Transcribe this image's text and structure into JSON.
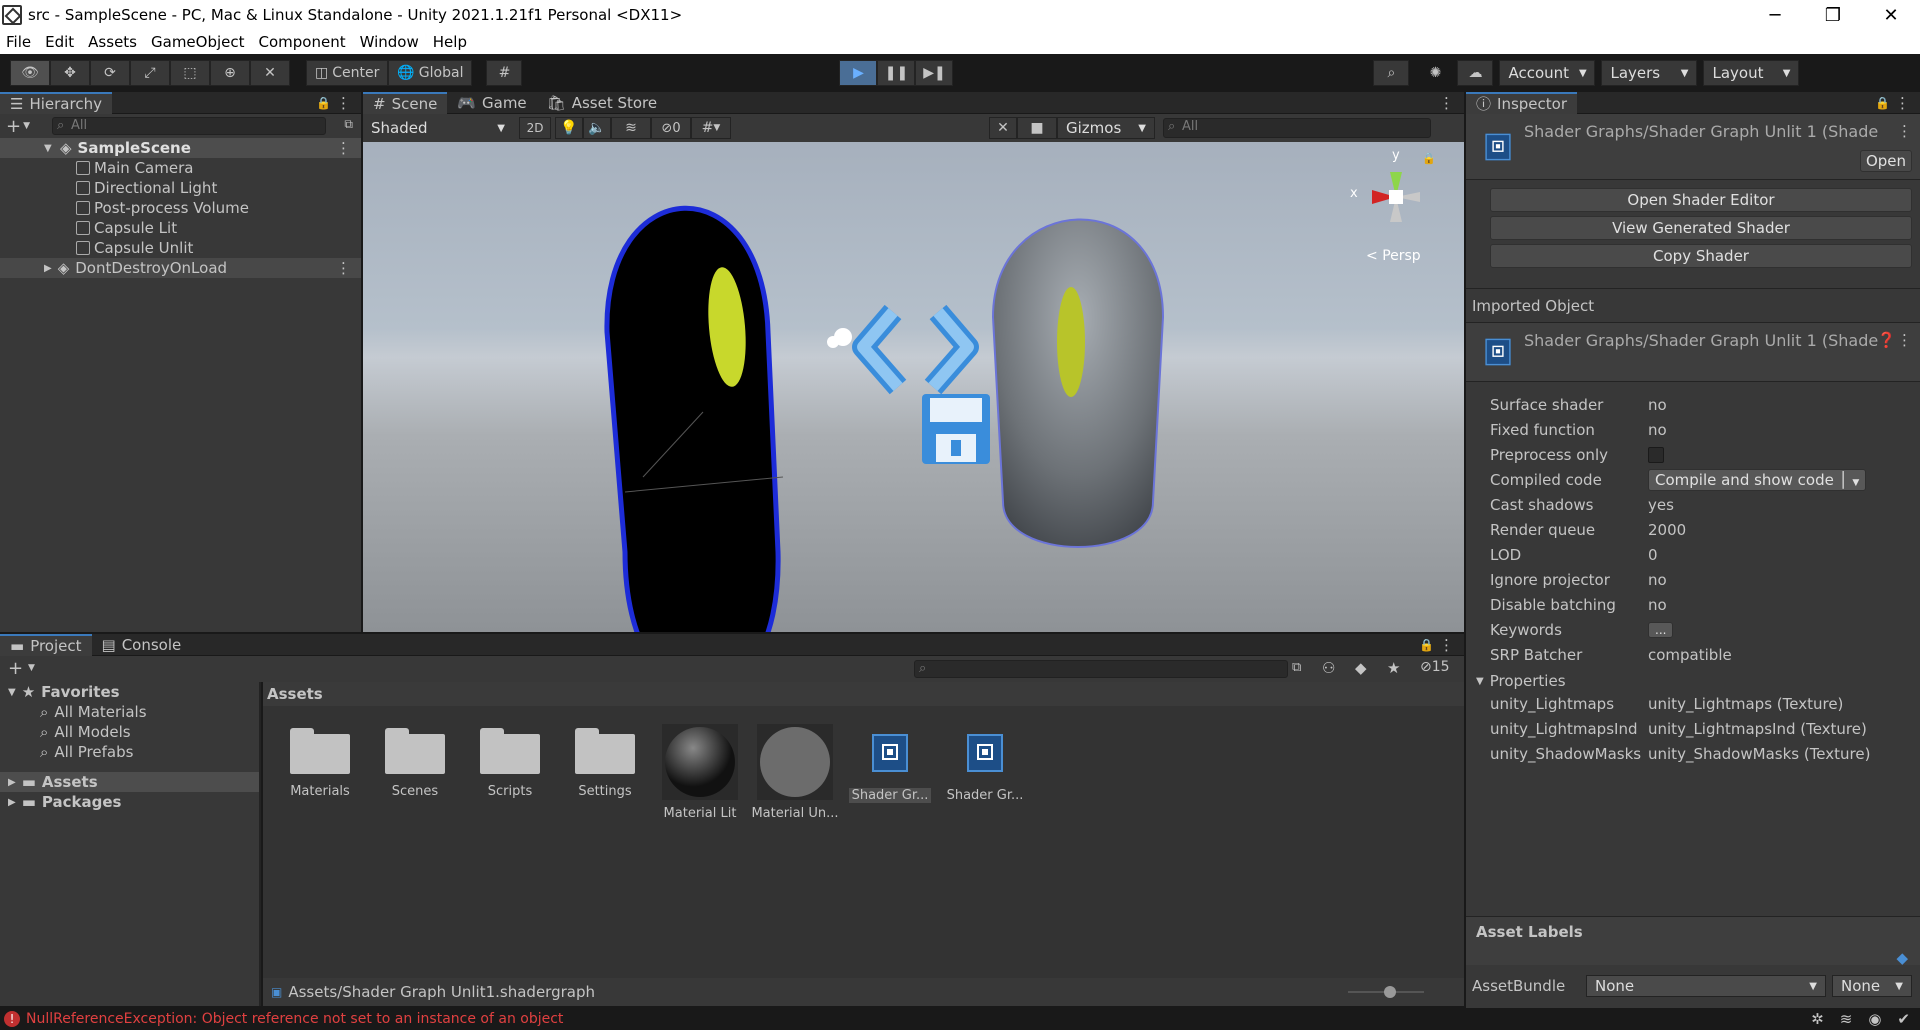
{
  "window": {
    "title": "src - SampleScene - PC, Mac & Linux Standalone - Unity 2021.1.21f1 Personal <DX11>",
    "minimize": "─",
    "maximize": "❐",
    "close": "✕"
  },
  "menu": [
    "File",
    "Edit",
    "Assets",
    "GameObject",
    "Component",
    "Window",
    "Help"
  ],
  "toolbar": {
    "center_label": "Center",
    "global_label": "Global",
    "account_label": "Account",
    "layers_label": "Layers",
    "layout_label": "Layout"
  },
  "hierarchy": {
    "tab": "Hierarchy",
    "search_placeholder": "All",
    "scene": "SampleScene",
    "items": [
      "Main Camera",
      "Directional Light",
      "Post-process Volume",
      "Capsule Lit",
      "Capsule  Unlit"
    ],
    "dont_destroy": "DontDestroyOnLoad"
  },
  "scene": {
    "tabs": [
      "Scene",
      "Game",
      "Asset Store"
    ],
    "shading": "Shaded",
    "mode_2d": "2D",
    "hidden_count": "0",
    "gizmos": "Gizmos",
    "search_placeholder": "All",
    "persp": "Persp",
    "axis_x": "x",
    "axis_y": "y"
  },
  "project": {
    "tabs": [
      "Project",
      "Console"
    ],
    "hidden_count": "15",
    "favorites": "Favorites",
    "fav_items": [
      "All Materials",
      "All Models",
      "All Prefabs"
    ],
    "tree": [
      "Assets",
      "Packages"
    ],
    "breadcrumb": "Assets",
    "assets": [
      "Materials",
      "Scenes",
      "Scripts",
      "Settings",
      "Material Lit",
      "Material Un...",
      "Shader Gr...",
      "Shader Gr..."
    ],
    "path": "Assets/Shader Graph  Unlit1.shadergraph"
  },
  "inspector": {
    "tab": "Inspector",
    "header_title": "Shader Graphs/Shader Graph  Unlit 1 (Shade",
    "open_label": "Open",
    "buttons": [
      "Open Shader Editor",
      "View Generated Shader",
      "Copy Shader"
    ],
    "imported_object": "Imported Object",
    "imported_title": "Shader Graphs/Shader Graph  Unlit 1 (Shade",
    "props": [
      {
        "k": "Surface shader",
        "v": "no"
      },
      {
        "k": "Fixed function",
        "v": "no"
      },
      {
        "k": "Preprocess only",
        "v": ""
      },
      {
        "k": "Compiled code",
        "v": "Compile and show code"
      },
      {
        "k": "Cast shadows",
        "v": "yes"
      },
      {
        "k": "Render queue",
        "v": "2000"
      },
      {
        "k": "LOD",
        "v": "0"
      },
      {
        "k": "Ignore projector",
        "v": "no"
      },
      {
        "k": "Disable batching",
        "v": "no"
      },
      {
        "k": "Keywords",
        "v": "..."
      },
      {
        "k": "SRP Batcher",
        "v": "compatible"
      }
    ],
    "properties_label": "Properties",
    "properties": [
      {
        "k": "unity_Lightmaps",
        "v": "unity_Lightmaps (Texture)"
      },
      {
        "k": "unity_LightmapsInd",
        "v": "unity_LightmapsInd (Texture)"
      },
      {
        "k": "unity_ShadowMasks",
        "v": "unity_ShadowMasks (Texture)"
      }
    ],
    "asset_labels": "Asset Labels",
    "asset_bundle": "AssetBundle",
    "bundle_value": "None",
    "bundle_variant": "None"
  },
  "status": {
    "error": "NullReferenceException: Object reference not set to an instance of an object"
  }
}
